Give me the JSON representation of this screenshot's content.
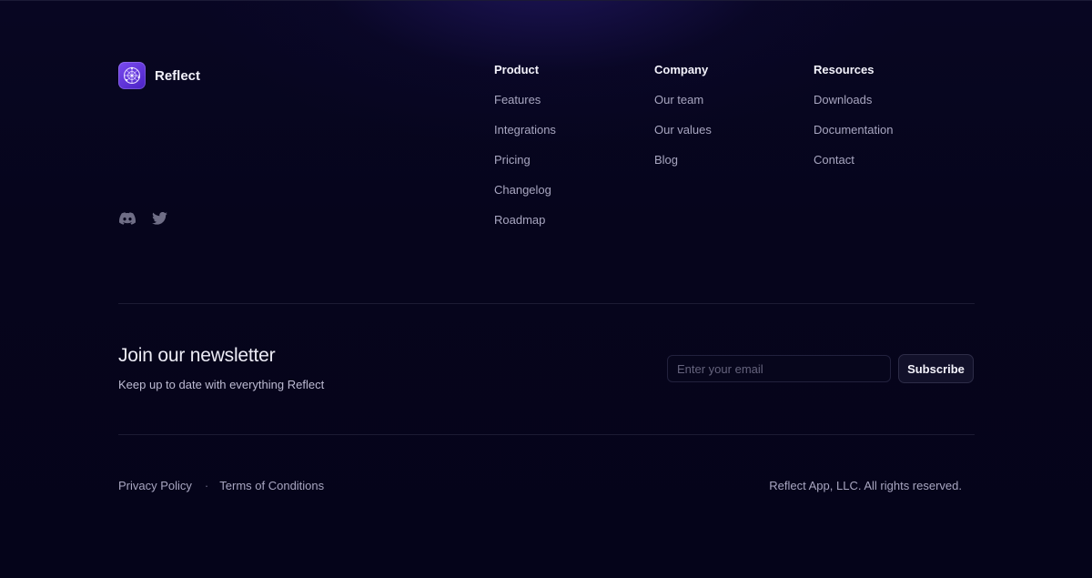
{
  "brand": {
    "name": "Reflect"
  },
  "social": {
    "discord_icon": "discord-icon",
    "twitter_icon": "twitter-icon"
  },
  "columns": [
    {
      "heading": "Product",
      "links": [
        "Features",
        "Integrations",
        "Pricing",
        "Changelog",
        "Roadmap"
      ]
    },
    {
      "heading": "Company",
      "links": [
        "Our team",
        "Our values",
        "Blog"
      ]
    },
    {
      "heading": "Resources",
      "links": [
        "Downloads",
        "Documentation",
        "Contact"
      ]
    }
  ],
  "newsletter": {
    "title": "Join our newsletter",
    "subtitle": "Keep up to date with everything Reflect",
    "email_placeholder": "Enter your email",
    "email_value": "",
    "button_label": "Subscribe"
  },
  "legal": {
    "privacy": "Privacy Policy",
    "separator": "·",
    "terms": "Terms of Conditions",
    "copyright": "Reflect App, LLC. All rights reserved."
  },
  "colors": {
    "background": "#05041a",
    "accent": "#6a3ce8",
    "text_primary": "#f2f1fa",
    "text_muted": "#a8a6c0"
  }
}
